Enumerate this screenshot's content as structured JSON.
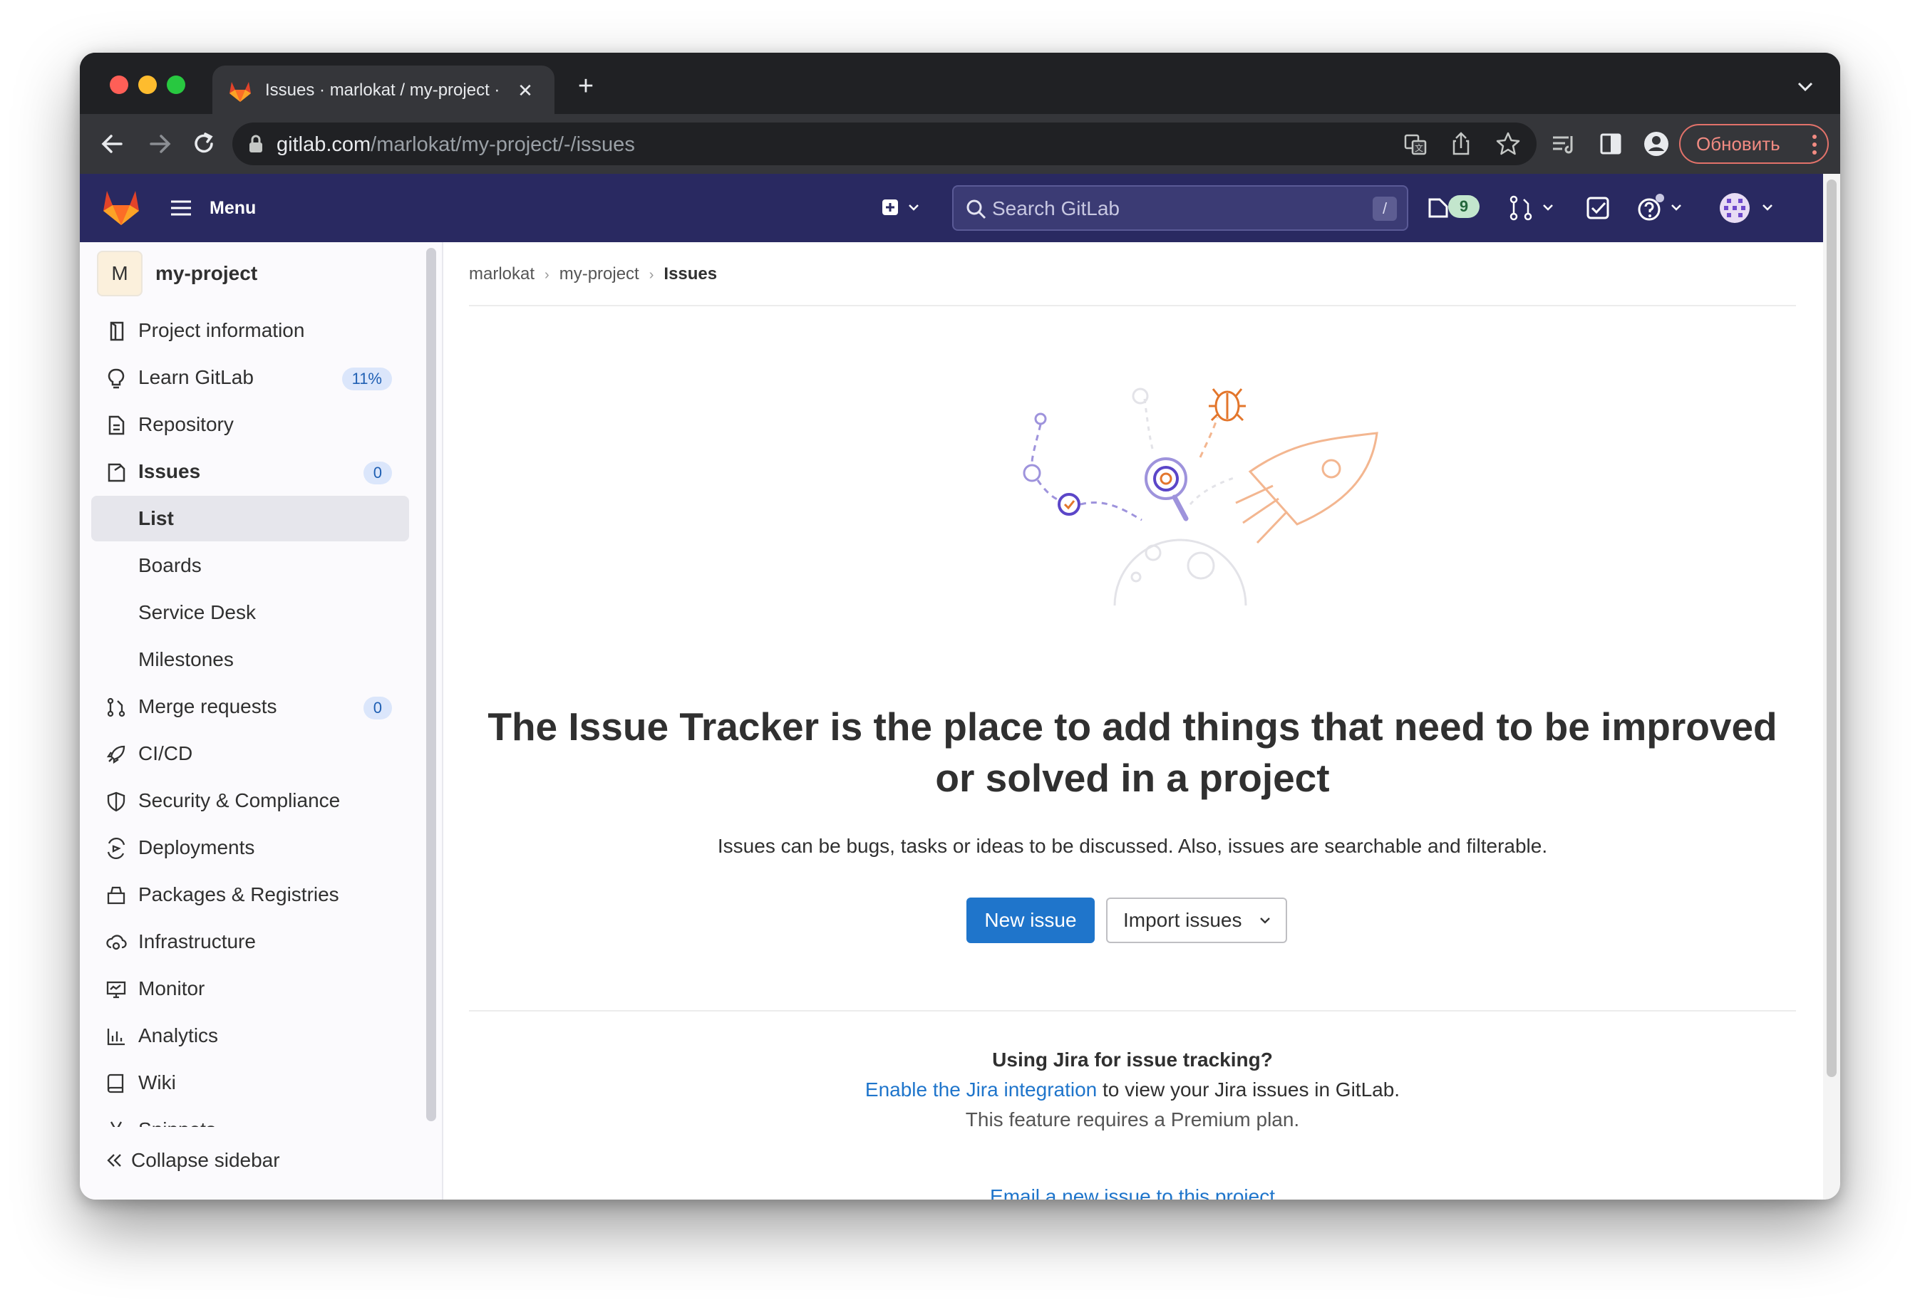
{
  "browser": {
    "tab_title": "Issues · marlokat / my-project · GitLab",
    "url_host": "gitlab.com",
    "url_path": "/marlokat/my-project/-/issues",
    "update_button": "Обновить"
  },
  "header": {
    "menu_label": "Menu",
    "search_placeholder": "Search GitLab",
    "search_shortcut": "/",
    "issues_count_badge": "9",
    "brand_color": "#292961"
  },
  "sidebar": {
    "project_avatar": "M",
    "project_name": "my-project",
    "items": [
      {
        "label": "Project information",
        "icon": "project-info-icon"
      },
      {
        "label": "Learn GitLab",
        "icon": "bulb-icon",
        "badge": "11%"
      },
      {
        "label": "Repository",
        "icon": "document-icon"
      },
      {
        "label": "Issues",
        "icon": "issues-icon",
        "badge": "0"
      },
      {
        "label": "List"
      },
      {
        "label": "Boards"
      },
      {
        "label": "Service Desk"
      },
      {
        "label": "Milestones"
      },
      {
        "label": "Merge requests",
        "icon": "merge-request-icon",
        "badge": "0"
      },
      {
        "label": "CI/CD",
        "icon": "rocket-icon"
      },
      {
        "label": "Security & Compliance",
        "icon": "shield-icon"
      },
      {
        "label": "Deployments",
        "icon": "deployments-icon"
      },
      {
        "label": "Packages & Registries",
        "icon": "package-icon"
      },
      {
        "label": "Infrastructure",
        "icon": "cloud-gear-icon"
      },
      {
        "label": "Monitor",
        "icon": "monitor-icon"
      },
      {
        "label": "Analytics",
        "icon": "chart-icon"
      },
      {
        "label": "Wiki",
        "icon": "book-icon"
      },
      {
        "label": "Snippets",
        "icon": "scissors-icon"
      }
    ],
    "collapse_label": "Collapse sidebar"
  },
  "breadcrumb": [
    "marlokat",
    "my-project",
    "Issues"
  ],
  "empty_state": {
    "title": "The Issue Tracker is the place to add things that need to be improved or solved in a project",
    "description": "Issues can be bugs, tasks or ideas to be discussed. Also, issues are searchable and filterable.",
    "new_issue_button": "New issue",
    "import_issues_button": "Import issues"
  },
  "jira": {
    "question": "Using Jira for issue tracking?",
    "link_text": "Enable the Jira integration",
    "link_suffix": " to view your Jira issues in GitLab.",
    "premium_note": "This feature requires a Premium plan."
  },
  "email_link": "Email a new issue to this project"
}
